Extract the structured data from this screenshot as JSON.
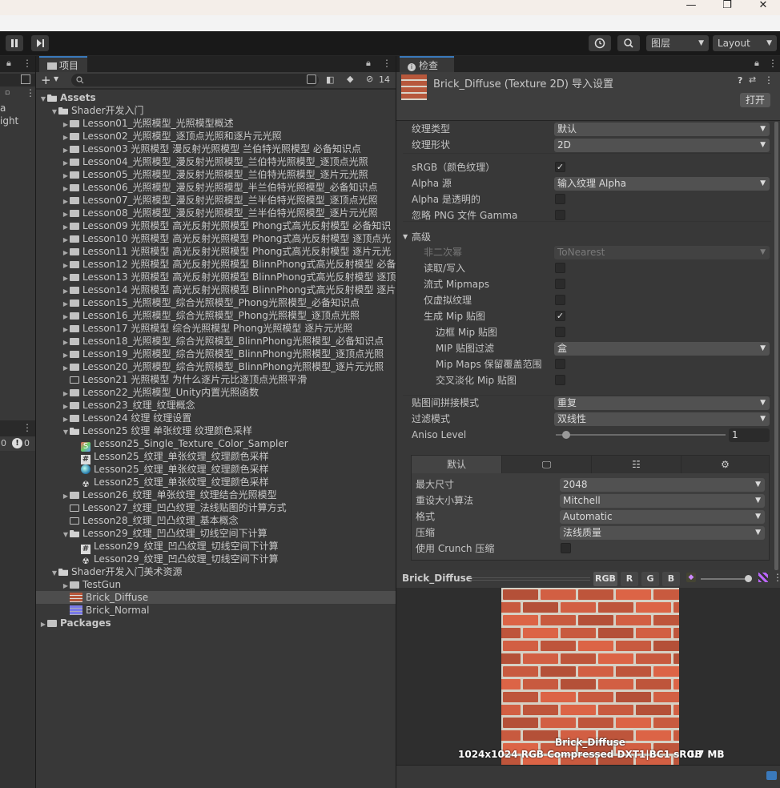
{
  "window": {
    "minimize": "—",
    "maximize": "❐",
    "close": "✕"
  },
  "toolbar": {
    "layers_label": "图层",
    "layout_label": "Layout",
    "history_icon": "history-icon",
    "search_icon": "search-icon"
  },
  "left_panel": {
    "items": [
      "a",
      "ight"
    ]
  },
  "bottom_left": {
    "count_a": "0",
    "count_b": "0"
  },
  "project": {
    "tab_label": "项目",
    "add_label": "+",
    "hidden_count": "14",
    "tree": [
      {
        "label": "Assets",
        "indent": 0,
        "kind": "folder-open",
        "expanded": true,
        "bold": true
      },
      {
        "label": "Shader开发入门",
        "indent": 1,
        "kind": "folder-open",
        "expanded": true
      },
      {
        "label": "Lesson01_光照模型_光照模型概述",
        "indent": 2,
        "kind": "folder",
        "collapsed": true
      },
      {
        "label": "Lesson02_光照模型_逐顶点光照和逐片元光照",
        "indent": 2,
        "kind": "folder",
        "collapsed": true
      },
      {
        "label": "Lesson03 光照模型 漫反射光照模型 兰伯特光照模型 必备知识点",
        "indent": 2,
        "kind": "folder",
        "collapsed": true
      },
      {
        "label": "Lesson04_光照模型_漫反射光照模型_兰伯特光照模型_逐顶点光照",
        "indent": 2,
        "kind": "folder",
        "collapsed": true
      },
      {
        "label": "Lesson05_光照模型_漫反射光照模型_兰伯特光照模型_逐片元光照",
        "indent": 2,
        "kind": "folder",
        "collapsed": true
      },
      {
        "label": "Lesson06_光照模型_漫反射光照模型_半兰伯特光照模型_必备知识点",
        "indent": 2,
        "kind": "folder",
        "collapsed": true
      },
      {
        "label": "Lesson07_光照模型_漫反射光照模型_兰半伯特光照模型_逐顶点光照",
        "indent": 2,
        "kind": "folder",
        "collapsed": true
      },
      {
        "label": "Lesson08_光照模型_漫反射光照模型_兰半伯特光照模型_逐片元光照",
        "indent": 2,
        "kind": "folder",
        "collapsed": true
      },
      {
        "label": "Lesson09 光照模型 高光反射光照模型 Phong式高光反射模型 必备知识",
        "indent": 2,
        "kind": "folder",
        "collapsed": true
      },
      {
        "label": "Lesson10 光照模型 高光反射光照模型 Phong式高光反射模型 逐顶点光",
        "indent": 2,
        "kind": "folder",
        "collapsed": true
      },
      {
        "label": "Lesson11 光照模型 高光反射光照模型 Phong式高光反射模型 逐片元光",
        "indent": 2,
        "kind": "folder",
        "collapsed": true
      },
      {
        "label": "Lesson12 光照模型 高光反射光照模型 BlinnPhong式高光反射模型 必备",
        "indent": 2,
        "kind": "folder",
        "collapsed": true
      },
      {
        "label": "Lesson13 光照模型 高光反射光照模型 BlinnPhong式高光反射模型 逐顶",
        "indent": 2,
        "kind": "folder",
        "collapsed": true
      },
      {
        "label": "Lesson14 光照模型 高光反射光照模型 BlinnPhong式高光反射模型 逐片",
        "indent": 2,
        "kind": "folder",
        "collapsed": true
      },
      {
        "label": "Lesson15_光照模型_综合光照模型_Phong光照模型_必备知识点",
        "indent": 2,
        "kind": "folder",
        "collapsed": true
      },
      {
        "label": "Lesson16_光照模型_综合光照模型_Phong光照模型_逐顶点光照",
        "indent": 2,
        "kind": "folder",
        "collapsed": true
      },
      {
        "label": "Lesson17 光照模型 综合光照模型 Phong光照模型 逐片元光照",
        "indent": 2,
        "kind": "folder",
        "collapsed": true
      },
      {
        "label": "Lesson18_光照模型_综合光照模型_BlinnPhong光照模型_必备知识点",
        "indent": 2,
        "kind": "folder",
        "collapsed": true
      },
      {
        "label": "Lesson19_光照模型_综合光照模型_BlinnPhong光照模型_逐顶点光照",
        "indent": 2,
        "kind": "folder",
        "collapsed": true
      },
      {
        "label": "Lesson20_光照模型_综合光照模型_BlinnPhong光照模型_逐片元光照",
        "indent": 2,
        "kind": "folder",
        "collapsed": true
      },
      {
        "label": "Lesson21 光照模型 为什么逐片元比逐顶点光照平滑",
        "indent": 2,
        "kind": "folder-empty"
      },
      {
        "label": "Lesson22_光照模型_Unity内置光照函数",
        "indent": 2,
        "kind": "folder",
        "collapsed": true
      },
      {
        "label": "Lesson23_纹理_纹理概念",
        "indent": 2,
        "kind": "folder",
        "collapsed": true
      },
      {
        "label": "Lesson24 纹理 纹理设置",
        "indent": 2,
        "kind": "folder",
        "collapsed": true
      },
      {
        "label": "Lesson25 纹理 单张纹理 纹理颜色采样",
        "indent": 2,
        "kind": "folder-open",
        "expanded": true
      },
      {
        "label": "Lesson25_Single_Texture_Color_Sampler",
        "indent": 3,
        "kind": "scene"
      },
      {
        "label": "Lesson25_纹理_单张纹理_纹理颜色采样",
        "indent": 3,
        "kind": "script"
      },
      {
        "label": "Lesson25_纹理_单张纹理_纹理颜色采样",
        "indent": 3,
        "kind": "material"
      },
      {
        "label": "Lesson25_纹理_单张纹理_纹理颜色采样",
        "indent": 3,
        "kind": "shader"
      },
      {
        "label": "Lesson26_纹理_单张纹理_纹理结合光照模型",
        "indent": 2,
        "kind": "folder",
        "collapsed": true
      },
      {
        "label": "Lesson27_纹理_凹凸纹理_法线贴图的计算方式",
        "indent": 2,
        "kind": "folder-empty"
      },
      {
        "label": "Lesson28_纹理_凹凸纹理_基本概念",
        "indent": 2,
        "kind": "folder-empty"
      },
      {
        "label": "Lesson29_纹理_凹凸纹理_切线空间下计算",
        "indent": 2,
        "kind": "folder-open",
        "expanded": true
      },
      {
        "label": "Lesson29_纹理_凹凸纹理_切线空间下计算",
        "indent": 3,
        "kind": "script"
      },
      {
        "label": "Lesson29_纹理_凹凸纹理_切线空间下计算",
        "indent": 3,
        "kind": "shader"
      },
      {
        "label": "Shader开发入门美术资源",
        "indent": 1,
        "kind": "folder-open",
        "expanded": true
      },
      {
        "label": "TestGun",
        "indent": 2,
        "kind": "folder",
        "collapsed": true
      },
      {
        "label": "Brick_Diffuse",
        "indent": 2,
        "kind": "texture-diffuse",
        "selected": true
      },
      {
        "label": "Brick_Normal",
        "indent": 2,
        "kind": "texture-normal"
      },
      {
        "label": "Packages",
        "indent": 0,
        "kind": "folder",
        "collapsed": true,
        "bold": true
      }
    ]
  },
  "inspector": {
    "tab_label": "检查器",
    "title": "Brick_Diffuse (Texture 2D) 导入设置",
    "open_button": "打开",
    "rows": [
      {
        "label": "纹理类型",
        "type": "dropdown",
        "value": "默认"
      },
      {
        "label": "纹理形状",
        "type": "dropdown",
        "value": "2D"
      },
      {
        "label": "sRGB（颜色纹理）",
        "type": "check",
        "checked": true
      },
      {
        "label": "Alpha 源",
        "type": "dropdown",
        "value": "输入纹理 Alpha"
      },
      {
        "label": "Alpha 是透明的",
        "type": "check",
        "checked": false
      },
      {
        "label": "忽略 PNG 文件 Gamma",
        "type": "check",
        "checked": false
      },
      {
        "label": "高级",
        "type": "foldout"
      },
      {
        "label": "非二次幂",
        "type": "dropdown",
        "value": "ToNearest",
        "disabled": true,
        "indent": 1
      },
      {
        "label": "读取/写入",
        "type": "check",
        "checked": false,
        "indent": 1
      },
      {
        "label": "流式 Mipmaps",
        "type": "check",
        "checked": false,
        "indent": 1
      },
      {
        "label": "仅虚拟纹理",
        "type": "check",
        "checked": false,
        "indent": 1
      },
      {
        "label": "生成 Mip 贴图",
        "type": "check",
        "checked": true,
        "indent": 1
      },
      {
        "label": "边框 Mip 贴图",
        "type": "check",
        "checked": false,
        "indent": 2
      },
      {
        "label": "MIP 贴图过滤",
        "type": "dropdown",
        "value": "盒",
        "indent": 2
      },
      {
        "label": "Mip Maps 保留覆盖范围",
        "type": "check",
        "checked": false,
        "indent": 2
      },
      {
        "label": "交叉淡化 Mip 贴图",
        "type": "check",
        "checked": false,
        "indent": 2
      },
      {
        "label": "贴图间拼接模式",
        "type": "dropdown",
        "value": "重复"
      },
      {
        "label": "过滤模式",
        "type": "dropdown",
        "value": "双线性"
      },
      {
        "label": "Aniso Level",
        "type": "slider",
        "value": "1",
        "fraction": 0.06
      }
    ],
    "platform_tabs": {
      "default_label": "默认"
    },
    "platform_rows": [
      {
        "label": "最大尺寸",
        "type": "dropdown",
        "value": "2048"
      },
      {
        "label": "重设大小算法",
        "type": "dropdown",
        "value": "Mitchell"
      },
      {
        "label": "格式",
        "type": "dropdown",
        "value": "Automatic"
      },
      {
        "label": "压缩",
        "type": "dropdown",
        "value": "法线质量"
      },
      {
        "label": "使用 Crunch 压缩",
        "type": "check",
        "checked": false
      }
    ]
  },
  "preview": {
    "title": "Brick_Diffuse",
    "channels": [
      "RGB",
      "R",
      "G",
      "B"
    ],
    "image_label": "Brick_Diffuse",
    "info": "1024x1024  RGB Compressed DXT1|BC1 sRGB",
    "size": "0.7 MB"
  },
  "colors": {
    "accent": "#3a79bb",
    "selection": "#4d4d4d",
    "brick": "#b7583c",
    "mortar": "#d9d4c8"
  }
}
